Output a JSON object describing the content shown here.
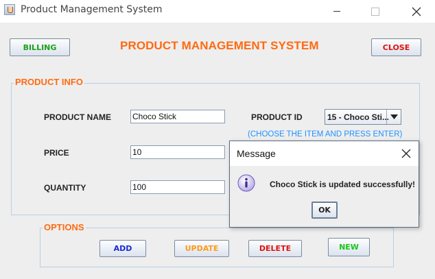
{
  "window": {
    "title": "Product Management System",
    "icon": "java-cup-icon"
  },
  "header": {
    "billing_label": "BILLING",
    "title": "PRODUCT MANAGEMENT SYSTEM",
    "close_label": "CLOSE"
  },
  "product_info": {
    "legend": "PRODUCT INFO",
    "name_label": "PRODUCT NAME",
    "name_value": "Choco Stick",
    "price_label": "PRICE",
    "price_value": "10",
    "quantity_label": "QUANTITY",
    "quantity_value": "100",
    "id_label": "PRODUCT ID",
    "id_selected": "15 - Choco Sti...",
    "hint": "(CHOOSE THE ITEM AND PRESS ENTER)"
  },
  "options": {
    "legend": "OPTIONS",
    "add_label": "ADD",
    "update_label": "UPDATE",
    "delete_label": "DELETE",
    "new_label": "NEW"
  },
  "dialog": {
    "title": "Message",
    "message": "Choco Stick is updated successfully!",
    "ok_label": "OK",
    "icon": "info-icon"
  },
  "colors": {
    "accent_orange": "#ff6a10",
    "billing_green": "#19a019",
    "close_red": "#e01010",
    "add_blue": "#1a2ad6",
    "update_orange": "#ff9a1a",
    "new_green": "#19c419",
    "hint_blue": "#1e90ff"
  }
}
